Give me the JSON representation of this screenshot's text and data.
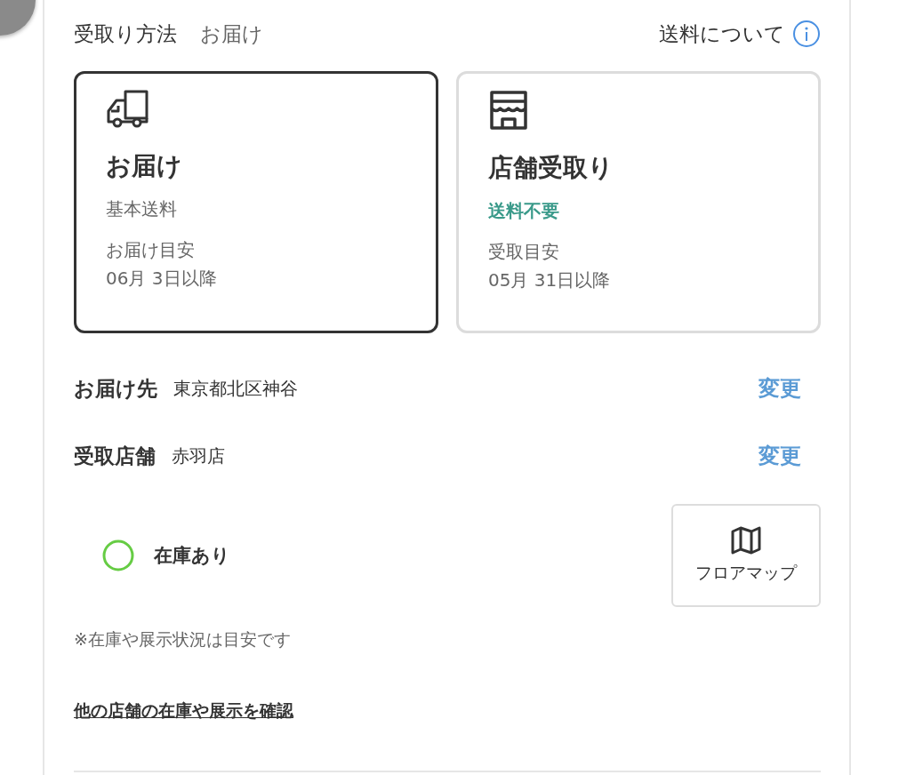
{
  "header": {
    "label": "受取り方法",
    "value": "お届け",
    "shipping_link": "送料について"
  },
  "methods": [
    {
      "kind": "truck",
      "title": "お届け",
      "fee": "基本送料",
      "fee_free": false,
      "eta_label": "お届け目安",
      "eta": "06月 3日以降",
      "selected": true
    },
    {
      "kind": "store",
      "title": "店舗受取り",
      "fee": "送料不要",
      "fee_free": true,
      "eta_label": "受取目安",
      "eta": "05月 31日以降",
      "selected": false
    }
  ],
  "details": [
    {
      "label": "お届け先",
      "value": "東京都北区神谷",
      "action": "変更"
    },
    {
      "label": "受取店舗",
      "value": "赤羽店",
      "action": "変更"
    }
  ],
  "stock": {
    "in_stock": true,
    "label": "在庫あり"
  },
  "floor_map_button": "フロアマップ",
  "note": "※在庫や展示状況は目安です",
  "other_stores_link": "他の店舗の在庫や展示を確認"
}
